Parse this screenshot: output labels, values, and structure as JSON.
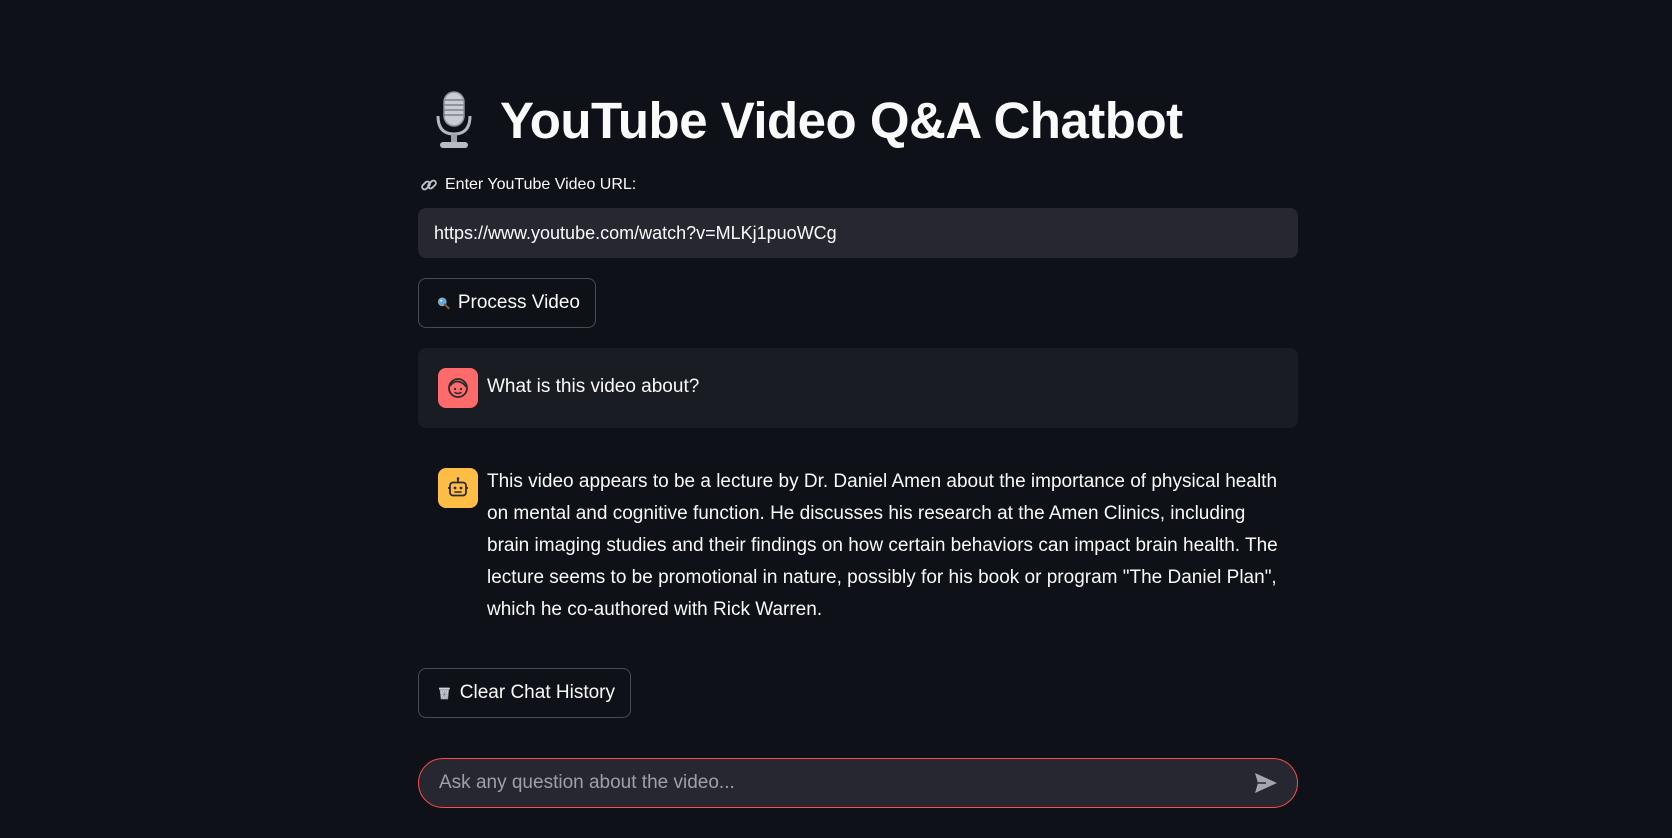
{
  "header": {
    "icon": "microphone-icon",
    "title": "YouTube Video Q&A Chatbot"
  },
  "url_field": {
    "icon": "link-icon",
    "label": "Enter YouTube Video URL:",
    "value": "https://www.youtube.com/watch?v=MLKj1puoWCg"
  },
  "process_button": {
    "icon": "magnifier-icon",
    "label": "Process Video"
  },
  "chat": {
    "messages": [
      {
        "role": "user",
        "avatar": "user-face-icon",
        "avatar_color": "#ff6b6b",
        "text": "What is this video about?"
      },
      {
        "role": "assistant",
        "avatar": "robot-icon",
        "avatar_color": "#ffbd45",
        "text": "This video appears to be a lecture by Dr. Daniel Amen about the importance of physical health on mental and cognitive function. He discusses his research at the Amen Clinics, including brain imaging studies and their findings on how certain behaviors can impact brain health. The lecture seems to be promotional in nature, possibly for his book or program \"The Daniel Plan\", which he co-authored with Rick Warren."
      }
    ]
  },
  "clear_button": {
    "icon": "wastebasket-icon",
    "label": "Clear Chat History"
  },
  "chat_input": {
    "placeholder": "Ask any question about the video...",
    "send_icon": "send-icon"
  },
  "colors": {
    "background": "#0e1117",
    "input_background": "#262730",
    "accent": "#ff4b4b"
  }
}
